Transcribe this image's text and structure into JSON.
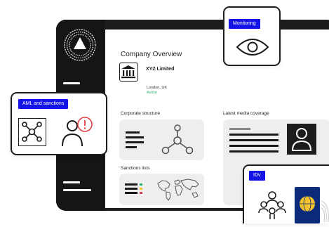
{
  "overview": {
    "title": "Company Overview",
    "company_name": "XYZ Limited",
    "location": "London, UK",
    "status": "Active"
  },
  "sections": {
    "corporate_structure": "Corporate structure",
    "latest_media": "Latest media coverage",
    "sanctions_lists": "Sanctions lists"
  },
  "panels": {
    "monitoring": "Monitoring",
    "aml": "AML and sanctions",
    "idv": "IDv"
  },
  "icons": [
    "logo-icon",
    "bank-icon",
    "network-icon",
    "person-icon",
    "alert-icon",
    "eye-icon",
    "world-map-icon",
    "passport-icon",
    "group-icon"
  ],
  "colors": {
    "accent": "#1414e6",
    "status_active": "#27b373",
    "alert": "#e0404a",
    "traffic_green": "#27b373",
    "traffic_amber": "#f2c12e",
    "traffic_red": "#e0404a",
    "passport": "#0b2a7a",
    "globe": "#f2c12e"
  }
}
